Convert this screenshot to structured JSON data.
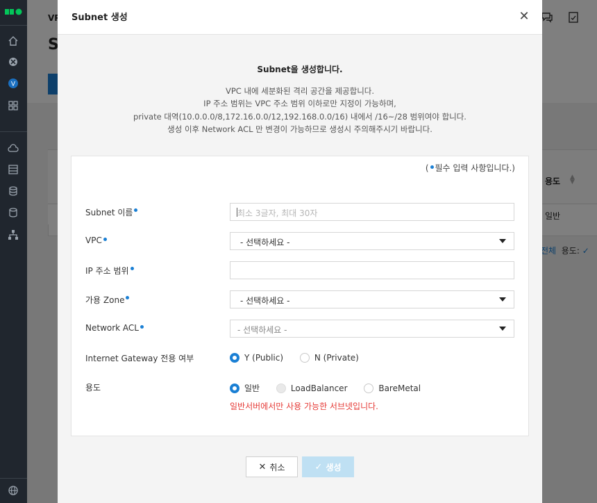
{
  "background": {
    "title_small": "VPC",
    "title_big": "S",
    "filter_all": "전체",
    "filter_usage_label": "용도:",
    "table_header_usage": "용도",
    "table_cell_usage": "일반"
  },
  "modal": {
    "title": "Subnet 생성",
    "intro_title": "Subnet을 생성합니다.",
    "intro_lines": [
      "VPC 내에 세분화된 격리 공간을 제공합니다.",
      "IP 주소 범위는 VPC 주소 범위 이하로만 지정이 가능하며,",
      "private 대역(10.0.0.0/8,172.16.0.0/12,192.168.0.0/16) 내에서 /16~/28 범위여야 합니다.",
      "생성 이후 Network ACL 만 변경이 가능하므로 생성시 주의해주시기 바랍니다."
    ],
    "required_note_open": "(",
    "required_note_text": "필수 입력 사항입니다.)",
    "fields": {
      "subnet_name": {
        "label": "Subnet 이름",
        "placeholder": "최소 3글자, 최대 30자",
        "value": ""
      },
      "vpc": {
        "label": "VPC",
        "selected": "- 선택하세요 -"
      },
      "ip_range": {
        "label": "IP 주소 범위",
        "value": ""
      },
      "zone": {
        "label": "가용 Zone",
        "selected": "- 선택하세요 -"
      },
      "network_acl": {
        "label": "Network ACL",
        "selected": "- 선택하세요 -"
      },
      "igw": {
        "label": "Internet Gateway 전용 여부",
        "options": [
          "Y (Public)",
          "N (Private)"
        ],
        "selected": "Y (Public)"
      },
      "usage": {
        "label": "용도",
        "options": [
          "일반",
          "LoadBalancer",
          "BareMetal"
        ],
        "selected": "일반",
        "note": "일반서버에서만 사용 가능한 서브넷입니다."
      }
    },
    "buttons": {
      "cancel": "취소",
      "create": "생성"
    }
  },
  "colors": {
    "accent": "#1a7fd4",
    "error": "#e53935",
    "nav_bg": "#20262e"
  }
}
